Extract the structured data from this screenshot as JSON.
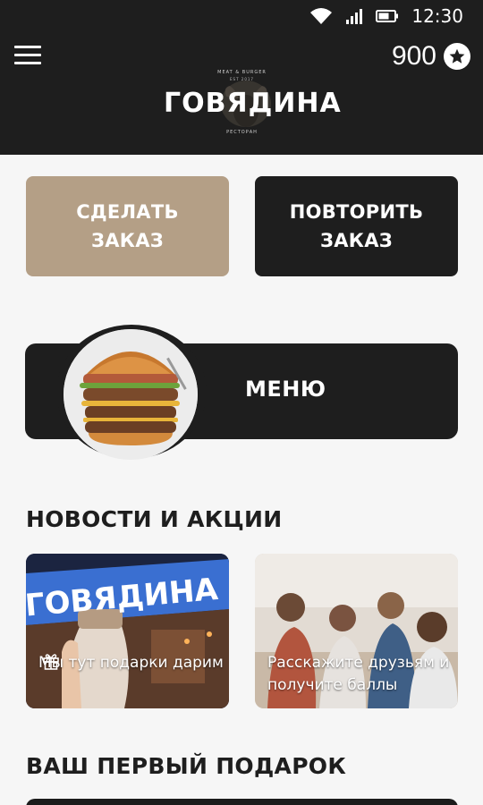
{
  "status_bar": {
    "time": "12:30",
    "icons": [
      "wifi-icon",
      "signal-icon",
      "battery-icon"
    ]
  },
  "header": {
    "points": "900",
    "points_icon": "star-icon",
    "logo": {
      "top": "MEAT & BURGER",
      "name": "ГОВЯДИНА",
      "est": "EST 2017",
      "bottom": "РЕСТОРАН"
    }
  },
  "actions": {
    "order_label": "СДЕЛАТЬ ЗАКАЗ",
    "repeat_label": "ПОВТОРИТЬ ЗАКАЗ"
  },
  "menu": {
    "label": "МЕНЮ"
  },
  "news": {
    "title": "НОВОСТИ И АКЦИИ",
    "items": [
      {
        "text": "Мы тут подарки дарим",
        "icon": "gift-icon",
        "sign": "ГОВЯДИНА"
      },
      {
        "text": "Расскажите друзьям и получите баллы"
      }
    ]
  },
  "gift": {
    "title": "ВАШ ПЕРВЫЙ ПОДАРОК"
  },
  "colors": {
    "dark": "#1e1e1e",
    "accent": "#b49f86",
    "background": "#f6f6f6"
  }
}
